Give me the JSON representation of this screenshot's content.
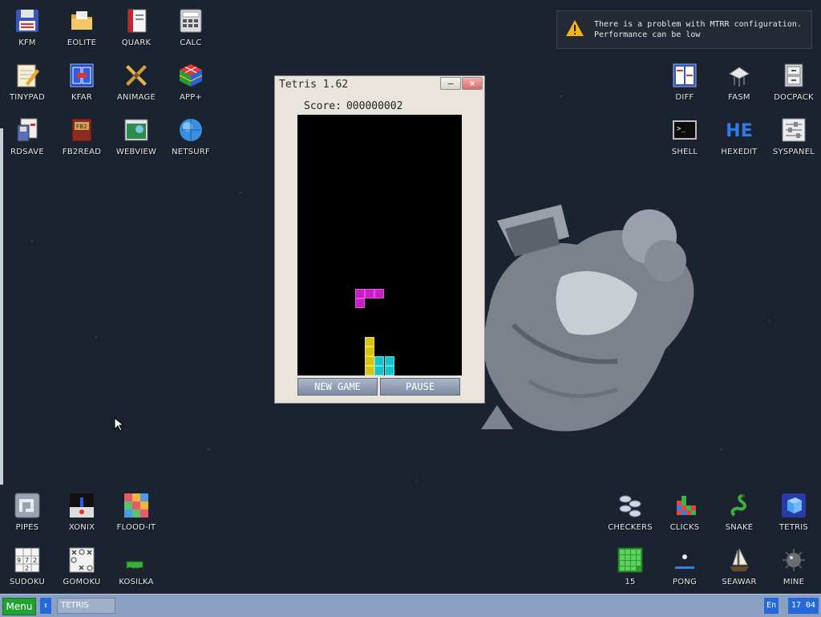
{
  "notification": {
    "line1": "There is a problem with MTRR configuration.",
    "line2": "Performance can be low"
  },
  "desktop_icons": {
    "kfm": "KFM",
    "eolite": "EOLITE",
    "quark": "QUARK",
    "calc": "CALC",
    "tinypad": "TINYPAD",
    "kfar": "KFAR",
    "animage": "ANIMAGE",
    "app_plus": "APP+",
    "rdsave": "RDSAVE",
    "fb2read": "FB2READ",
    "webview": "WEBVIEW",
    "netsurf": "NETSURF",
    "diff": "DIFF",
    "fasm": "FASM",
    "docpack": "DOCPACK",
    "shell": "SHELL",
    "hexedit": "HEXEDIT",
    "syspanel": "SYSPANEL",
    "pipes": "PIPES",
    "xonix": "XONIX",
    "flood_it": "FLOOD-IT",
    "sudoku": "SUDOKU",
    "gomoku": "GOMOKU",
    "kosilka": "KOSILKA",
    "checkers": "CHECKERS",
    "clicks": "CLICKS",
    "snake": "SNAKE",
    "tetris": "TETRIS",
    "fifteen": "15",
    "pong": "PONG",
    "seawar": "SEAWAR",
    "mine": "MINE"
  },
  "tetris_window": {
    "title": "Tetris 1.62",
    "minimize_glyph": "–",
    "close_glyph": "×",
    "score_label": "Score:",
    "score_value": "000000002",
    "new_game_label": "NEW GAME",
    "pause_label": "PAUSE",
    "board": {
      "columns": 17,
      "rows": 27,
      "falling_piece": {
        "color": "#c81fc4",
        "cells": [
          [
            6,
            18
          ],
          [
            7,
            18
          ],
          [
            8,
            18
          ],
          [
            6,
            19
          ]
        ]
      },
      "settled": [
        {
          "color": "#d6c41a",
          "cells": [
            [
              7,
              23
            ],
            [
              7,
              24
            ],
            [
              7,
              25
            ],
            [
              7,
              26
            ]
          ]
        },
        {
          "color": "#19c2c8",
          "cells": [
            [
              8,
              25
            ],
            [
              9,
              25
            ],
            [
              8,
              26
            ],
            [
              9,
              26
            ]
          ]
        }
      ]
    }
  },
  "taskbar": {
    "menu_label": "Menu",
    "switch_glyph": "↕",
    "active_task": "TETRIS",
    "language": "En",
    "clock": "17 04"
  },
  "colors": {
    "desktop_bg": "#1c2330",
    "taskbar_bg": "#8aa0c2",
    "menu_green": "#20a233",
    "accent_blue": "#2568d8"
  }
}
